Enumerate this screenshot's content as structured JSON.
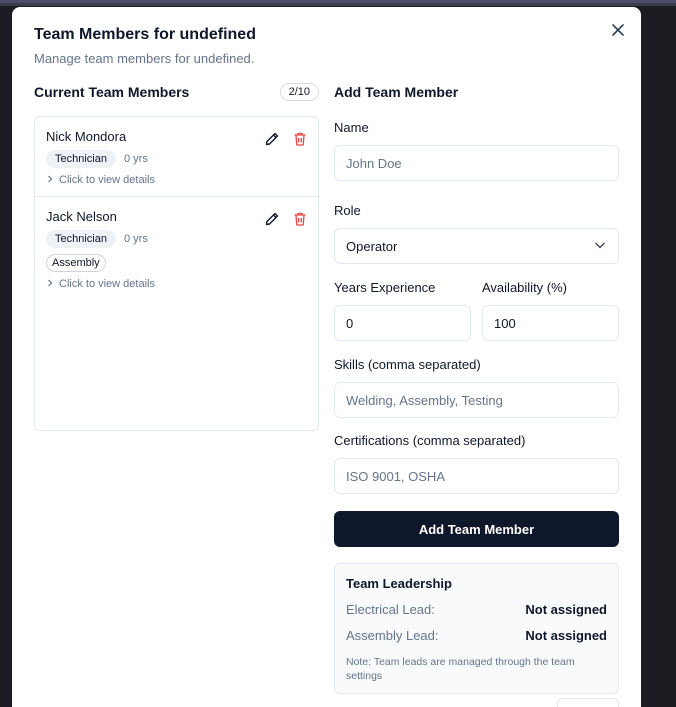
{
  "modal": {
    "title": "Team Members for undefined",
    "subtitle": "Manage team members for undefined.",
    "close_icon": "close-icon"
  },
  "current": {
    "title": "Current Team Members",
    "count": "2/10",
    "details_label": "Click to view details",
    "members": [
      {
        "name": "Nick Mondora",
        "role": "Technician",
        "experience": "0 yrs",
        "skills": []
      },
      {
        "name": "Jack Nelson",
        "role": "Technician",
        "experience": "0 yrs",
        "skills": [
          "Assembly"
        ]
      }
    ]
  },
  "form": {
    "title": "Add Team Member",
    "name_label": "Name",
    "name_placeholder": "John Doe",
    "role_label": "Role",
    "role_value": "Operator",
    "years_label": "Years Experience",
    "years_value": "0",
    "availability_label": "Availability (%)",
    "availability_value": "100",
    "skills_label": "Skills (comma separated)",
    "skills_placeholder": "Welding, Assembly, Testing",
    "certs_label": "Certifications (comma separated)",
    "certs_placeholder": "ISO 9001, OSHA",
    "submit_label": "Add Team Member"
  },
  "leadership": {
    "title": "Team Leadership",
    "rows": [
      {
        "label": "Electrical Lead:",
        "value": "Not assigned"
      },
      {
        "label": "Assembly Lead:",
        "value": "Not assigned"
      }
    ],
    "note": "Note: Team leads are managed through the team settings"
  },
  "colors": {
    "primary": "#0f172a",
    "danger": "#ef4444",
    "muted": "#64748b",
    "border": "#e2e8f0"
  }
}
